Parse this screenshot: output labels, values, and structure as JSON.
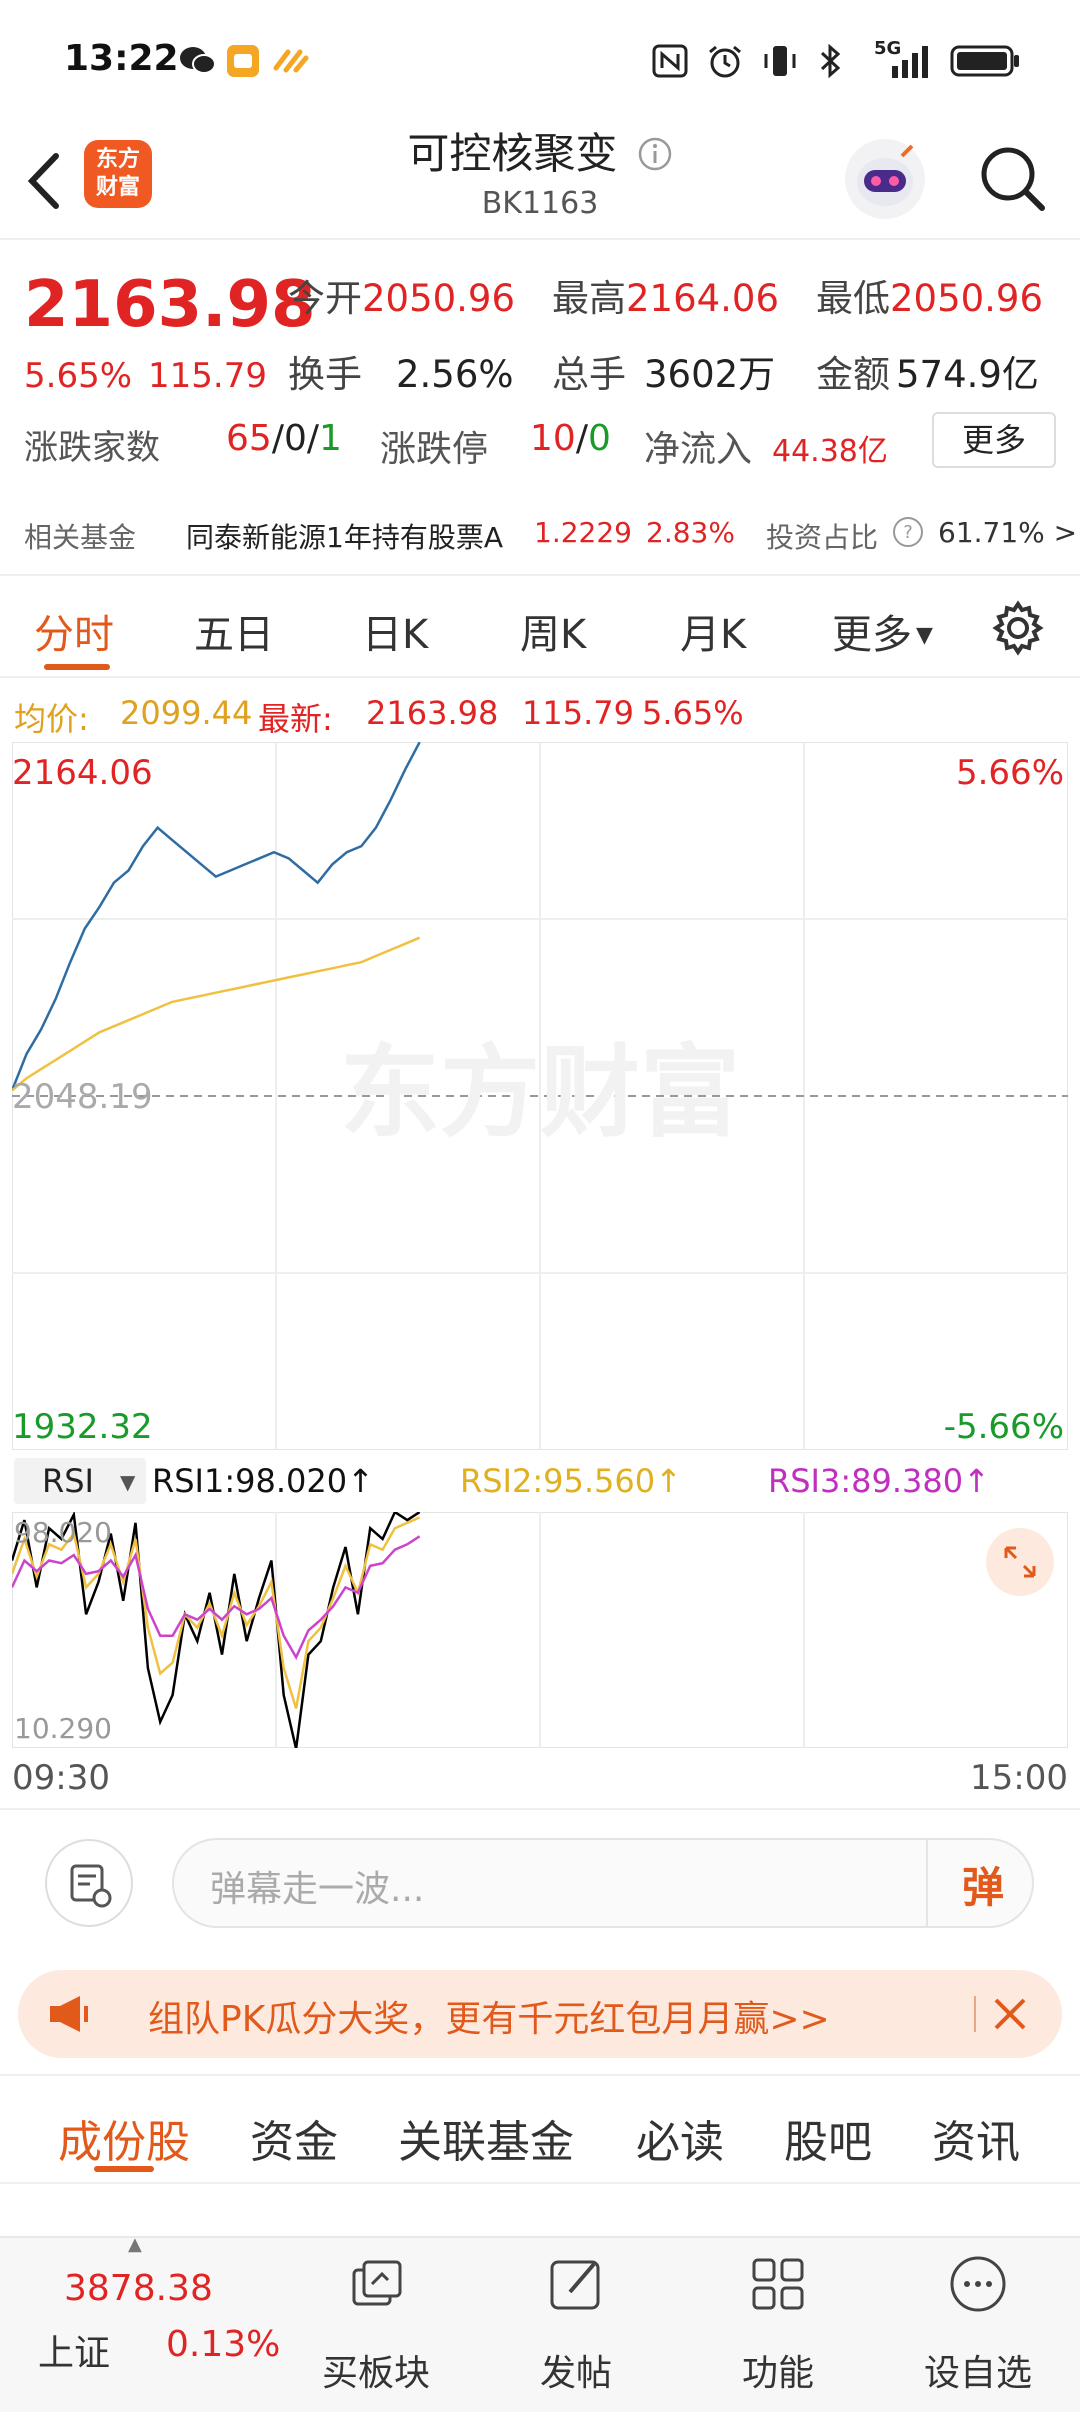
{
  "status_bar": {
    "time": "13:22",
    "network": "5G"
  },
  "header": {
    "logo_text": "东方\n财富",
    "title": "可控核聚变",
    "code": "BK1163"
  },
  "quote": {
    "last_price": "2163.98",
    "change_pct": "5.65%",
    "change_val": "115.79",
    "open_label": "今开",
    "open": "2050.96",
    "high_label": "最高",
    "high": "2164.06",
    "low_label": "最低",
    "low": "2050.96",
    "turnover_label": "换手",
    "turnover": "2.56%",
    "volume_label": "总手",
    "volume": "3602万",
    "amount_label": "金额",
    "amount": "574.9亿",
    "breadth_label": "涨跌家数",
    "up": "65",
    "flat": "0",
    "down": "1",
    "limit_label": "涨跌停",
    "limit_up": "10",
    "limit_down": "0",
    "netflow_label": "净流入",
    "netflow": "44.38亿",
    "more_button": "更多",
    "sep": "/"
  },
  "fund": {
    "label": "相关基金",
    "name": "同泰新能源1年持有股票A",
    "nav": "1.2229",
    "pct": "2.83%",
    "ratio_label": "投资占比",
    "ratio": "61.71% >"
  },
  "chart_tabs": [
    "分时",
    "五日",
    "日K",
    "周K",
    "月K",
    "更多"
  ],
  "avg_row": {
    "avg_label": "均价:",
    "avg": "2099.44",
    "latest_label": "最新:",
    "latest": "2163.98",
    "chg": "115.79",
    "pct": "5.65%"
  },
  "chart_data": {
    "type": "line",
    "x": [
      "09:30",
      "15:00"
    ],
    "y_high": "2164.06",
    "y_mid": "2048.19",
    "y_low": "1932.32",
    "pct_high": "5.66%",
    "pct_low": "-5.66%",
    "watermark": "东方财富",
    "series": [
      {
        "color": "#2e6da4",
        "values": [
          2050,
          2062,
          2070,
          2080,
          2092,
          2103,
          2110,
          2118,
          2122,
          2130,
          2136,
          2132,
          2128,
          2124,
          2120,
          2122,
          2124,
          2126,
          2128,
          2126,
          2122,
          2118,
          2124,
          2128,
          2130,
          2136,
          2145,
          2155,
          2164
        ]
      },
      {
        "color": "#f0c040",
        "values": [
          2050,
          2054,
          2057,
          2060,
          2063,
          2066,
          2069,
          2071,
          2073,
          2075,
          2077,
          2079,
          2080,
          2081,
          2082,
          2083,
          2084,
          2085,
          2086,
          2087,
          2088,
          2089,
          2090,
          2091,
          2092,
          2094,
          2096,
          2098,
          2100
        ]
      }
    ]
  },
  "rsi": {
    "selector": "RSI",
    "rsi1": "RSI1:98.020↑",
    "rsi2": "RSI2:95.560↑",
    "rsi3": "RSI3:89.380↑",
    "top": "98.020",
    "bottom": "10.290"
  },
  "rsi_chart_data": {
    "type": "line",
    "series": [
      {
        "name": "RSI1",
        "color": "#000000",
        "values": [
          80,
          95,
          70,
          92,
          88,
          97,
          60,
          72,
          90,
          65,
          94,
          40,
          20,
          30,
          60,
          50,
          68,
          45,
          75,
          50,
          66,
          80,
          30,
          10,
          45,
          50,
          70,
          85,
          60,
          92,
          88,
          98,
          95,
          98
        ]
      },
      {
        "name": "RSI2",
        "color": "#f0c040",
        "values": [
          75,
          88,
          74,
          86,
          84,
          90,
          70,
          75,
          86,
          72,
          88,
          55,
          38,
          42,
          60,
          55,
          64,
          52,
          68,
          56,
          63,
          72,
          40,
          25,
          50,
          55,
          66,
          78,
          68,
          86,
          84,
          92,
          94,
          96
        ]
      },
      {
        "name": "RSI3",
        "color": "#cc44cc",
        "values": [
          70,
          80,
          76,
          80,
          79,
          82,
          75,
          76,
          80,
          74,
          82,
          62,
          52,
          52,
          60,
          58,
          62,
          58,
          63,
          60,
          62,
          66,
          52,
          44,
          54,
          58,
          63,
          70,
          68,
          78,
          79,
          84,
          86,
          89
        ]
      }
    ]
  },
  "time_axis": {
    "start": "09:30",
    "end": "15:00"
  },
  "comment": {
    "placeholder": "弹幕走一波...",
    "send_label": "弹"
  },
  "banner": {
    "text": "组队PK瓜分大奖，更有千元红包月月赢>>"
  },
  "bottom_tabs": [
    "成份股",
    "资金",
    "关联基金",
    "必读",
    "股吧",
    "资讯"
  ],
  "bottom_nav": {
    "index_value": "3878.38",
    "index_name": "上证",
    "index_pct": "0.13%",
    "items": [
      "买板块",
      "发帖",
      "功能",
      "设自选"
    ]
  }
}
